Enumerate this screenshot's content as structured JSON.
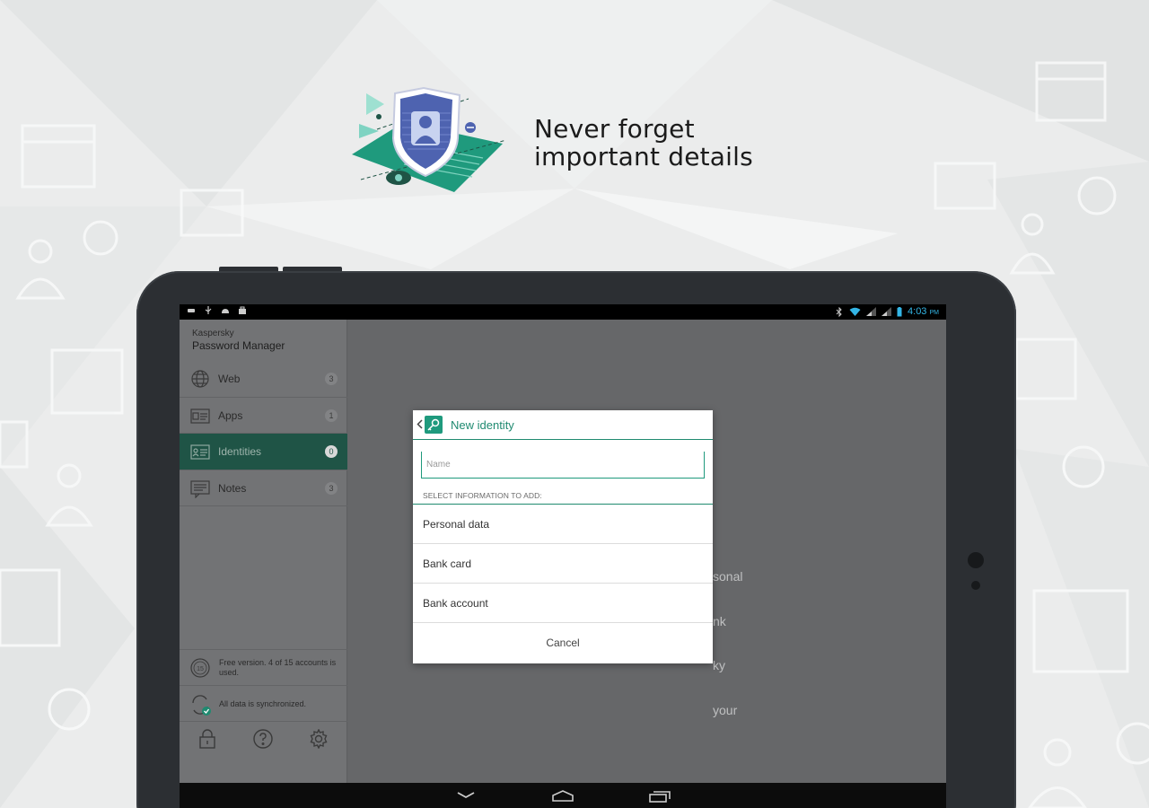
{
  "hero": {
    "title_line1": "Never forget",
    "title_line2": "important details"
  },
  "status_bar": {
    "time": "4:03",
    "ampm": "PM",
    "left_icons": [
      "usb-icon",
      "android-debug-icon",
      "briefcase-icon"
    ],
    "right_icons": [
      "bluetooth-off-icon",
      "wifi-icon",
      "signal-icon",
      "signal-icon",
      "battery-icon"
    ]
  },
  "app": {
    "company": "Kaspersky",
    "product": "Password Manager",
    "accent_color": "#1f9a7d",
    "active_nav_bg": "#1f5446"
  },
  "nav": {
    "items": [
      {
        "label": "Web",
        "count": "3",
        "icon": "globe-icon"
      },
      {
        "label": "Apps",
        "count": "1",
        "icon": "apps-card-icon"
      },
      {
        "label": "Identities",
        "count": "0",
        "icon": "id-card-icon",
        "active": true
      },
      {
        "label": "Notes",
        "count": "3",
        "icon": "notes-icon"
      }
    ]
  },
  "footer": {
    "license_text": "Free version. 4 of 15 accounts is used.",
    "license_badge": "15",
    "sync_text": "All data is synchronized."
  },
  "content_peek": {
    "lines": [
      "sonal",
      "nk",
      "ky",
      "your"
    ]
  },
  "dialog": {
    "title": "New identity",
    "name_placeholder": "Name",
    "section_label": "SELECT INFORMATION TO ADD:",
    "options": [
      "Personal data",
      "Bank card",
      "Bank account"
    ],
    "cancel": "Cancel"
  }
}
